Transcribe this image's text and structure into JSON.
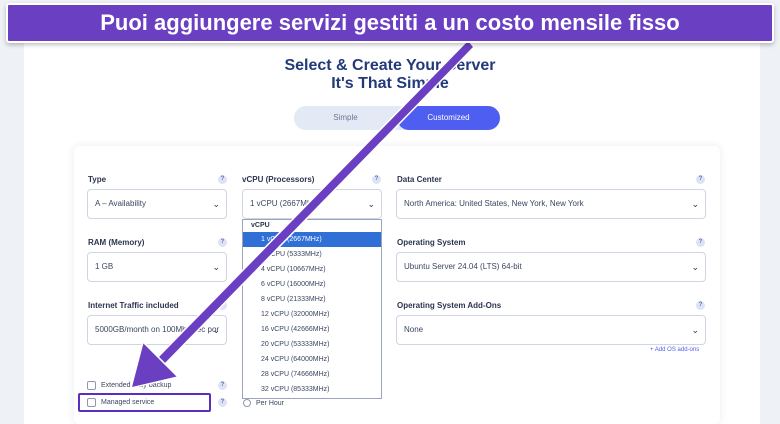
{
  "banner": {
    "text": "Puoi aggiungere servizi gestiti a un costo mensile fisso"
  },
  "page": {
    "title_line1": "Select & Create Your Server",
    "title_line2": "It's That Simple"
  },
  "mode_toggle": {
    "simple": "Simple",
    "customized": "Customized",
    "active": "Customized"
  },
  "help_glyph": "?",
  "caret_glyph": "⌄",
  "form": {
    "type": {
      "label": "Type",
      "value": "A – Availability"
    },
    "vcpu": {
      "label": "vCPU (Processors)",
      "value": "1 vCPU (2667MHz)",
      "dropdown_header": "vCPU",
      "options": [
        "1 vCPU (2667MHz)",
        "2 vCPU (5333MHz)",
        "4 vCPU (10667MHz)",
        "6 vCPU (16000MHz)",
        "8 vCPU (21333MHz)",
        "12 vCPU (32000MHz)",
        "16 vCPU (42666MHz)",
        "20 vCPU (53333MHz)",
        "24 vCPU (64000MHz)",
        "28 vCPU (74666MHz)",
        "32 vCPU (85333MHz)"
      ],
      "selected_index": 0
    },
    "data_center": {
      "label": "Data Center",
      "value": "North America: United States, New York, New York"
    },
    "ram": {
      "label": "RAM (Memory)",
      "value": "1 GB"
    },
    "os": {
      "label": "Operating System",
      "value": "Ubuntu Server 24.04 (LTS) 64-bit"
    },
    "traffic": {
      "label": "Internet Traffic included",
      "value": "5000GB/month on 100Mbit/sec por"
    },
    "os_addons": {
      "label": "Operating System Add-Ons",
      "value": "None",
      "add_link": "+ Add OS add-ons"
    },
    "options": {
      "extended_backup": "Extended daily backup",
      "managed_service": "Managed service",
      "per_hour": "Per Hour"
    }
  },
  "colors": {
    "banner": "#6a3fc2",
    "accent": "#4e5ef0",
    "selected_option": "#2f6fd6",
    "arrow": "#6a3fc2"
  }
}
